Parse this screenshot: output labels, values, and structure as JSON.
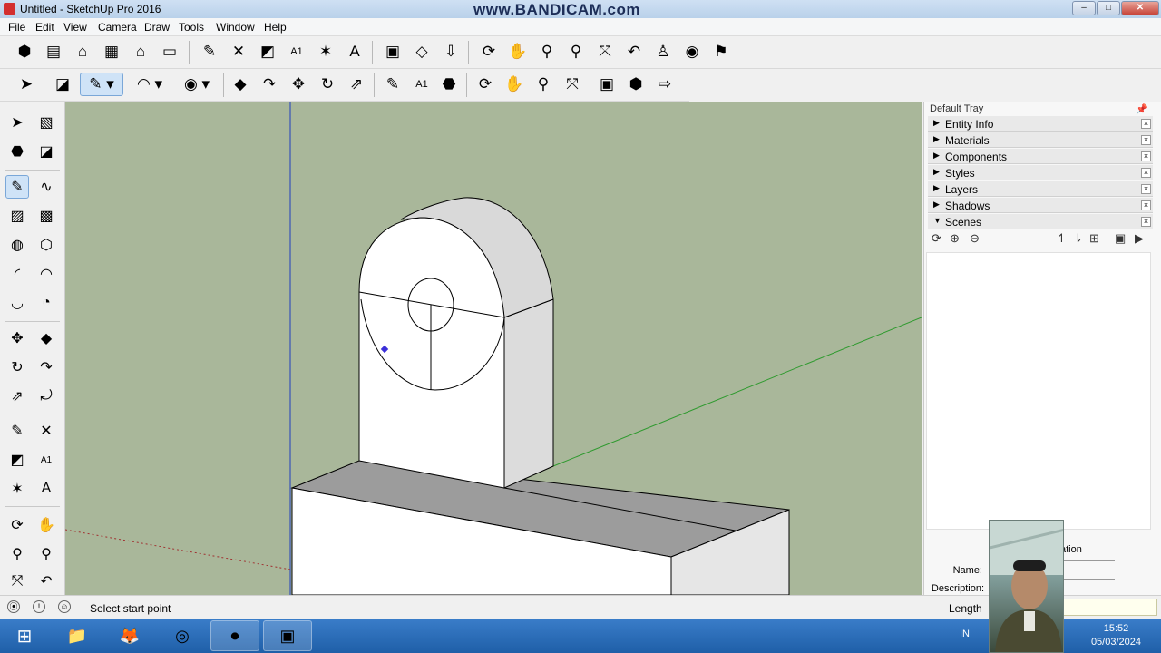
{
  "window": {
    "title": "Untitled - SketchUp Pro 2016",
    "watermark": "www.BANDICAM.com",
    "minimize_label": "–",
    "maximize_label": "□",
    "close_label": "✕"
  },
  "menu": [
    "File",
    "Edit",
    "View",
    "Camera",
    "Draw",
    "Tools",
    "Window",
    "Help"
  ],
  "tray": {
    "title": "Default Tray",
    "panels": [
      {
        "label": "Entity Info",
        "expanded": false
      },
      {
        "label": "Materials",
        "expanded": false
      },
      {
        "label": "Components",
        "expanded": false
      },
      {
        "label": "Styles",
        "expanded": false
      },
      {
        "label": "Layers",
        "expanded": false
      },
      {
        "label": "Shadows",
        "expanded": false
      },
      {
        "label": "Scenes",
        "expanded": true
      }
    ],
    "close_glyph": "×",
    "collapsed_arrow": "▶",
    "expanded_arrow": "▼",
    "scenes": {
      "partial_heading": "ation",
      "name_label": "Name:",
      "description_label": "Description:"
    }
  },
  "statusbar": {
    "hint": "Select start point",
    "length_label": "Length",
    "vcb_value": ""
  },
  "taskbar": {
    "time": "15:52",
    "date": "05/03/2024",
    "language": "IN"
  },
  "colors": {
    "viewport_background": "#a9b79a",
    "face_front": "#ffffff",
    "face_top": "#9c9c9c",
    "edge": "#000000",
    "green_axis": "#2f9a2f",
    "blue_axis": "#1f3fbf",
    "red_axis": "#a03030"
  },
  "icons": {
    "window_icon": "sketchup-icon",
    "pencil_active": "pencil-icon"
  }
}
